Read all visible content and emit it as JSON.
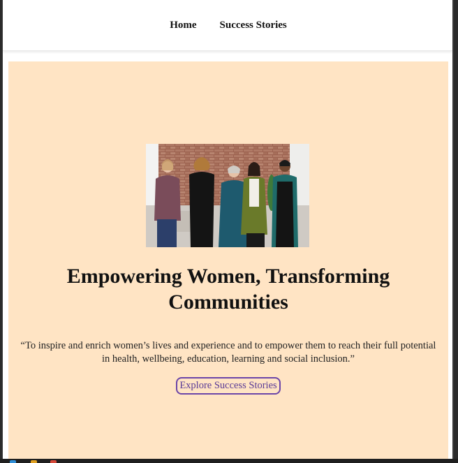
{
  "nav": {
    "items": [
      {
        "label": "Home"
      },
      {
        "label": "Success Stories"
      }
    ]
  },
  "hero": {
    "image": {
      "name": "group-photo-five-women"
    },
    "title": "Empowering Women, Transforming Communities",
    "quote": "“To inspire and enrich women’s lives and experience and to empower them to reach their full potential in health, wellbeing, education, learning and social inclusion.”",
    "cta_label": "Explore Success Stories"
  },
  "colors": {
    "hero_background": "#ffe4c4",
    "cta_border": "#6b45a8",
    "cta_text": "#5a3a96",
    "nav_background": "#ffffff"
  }
}
